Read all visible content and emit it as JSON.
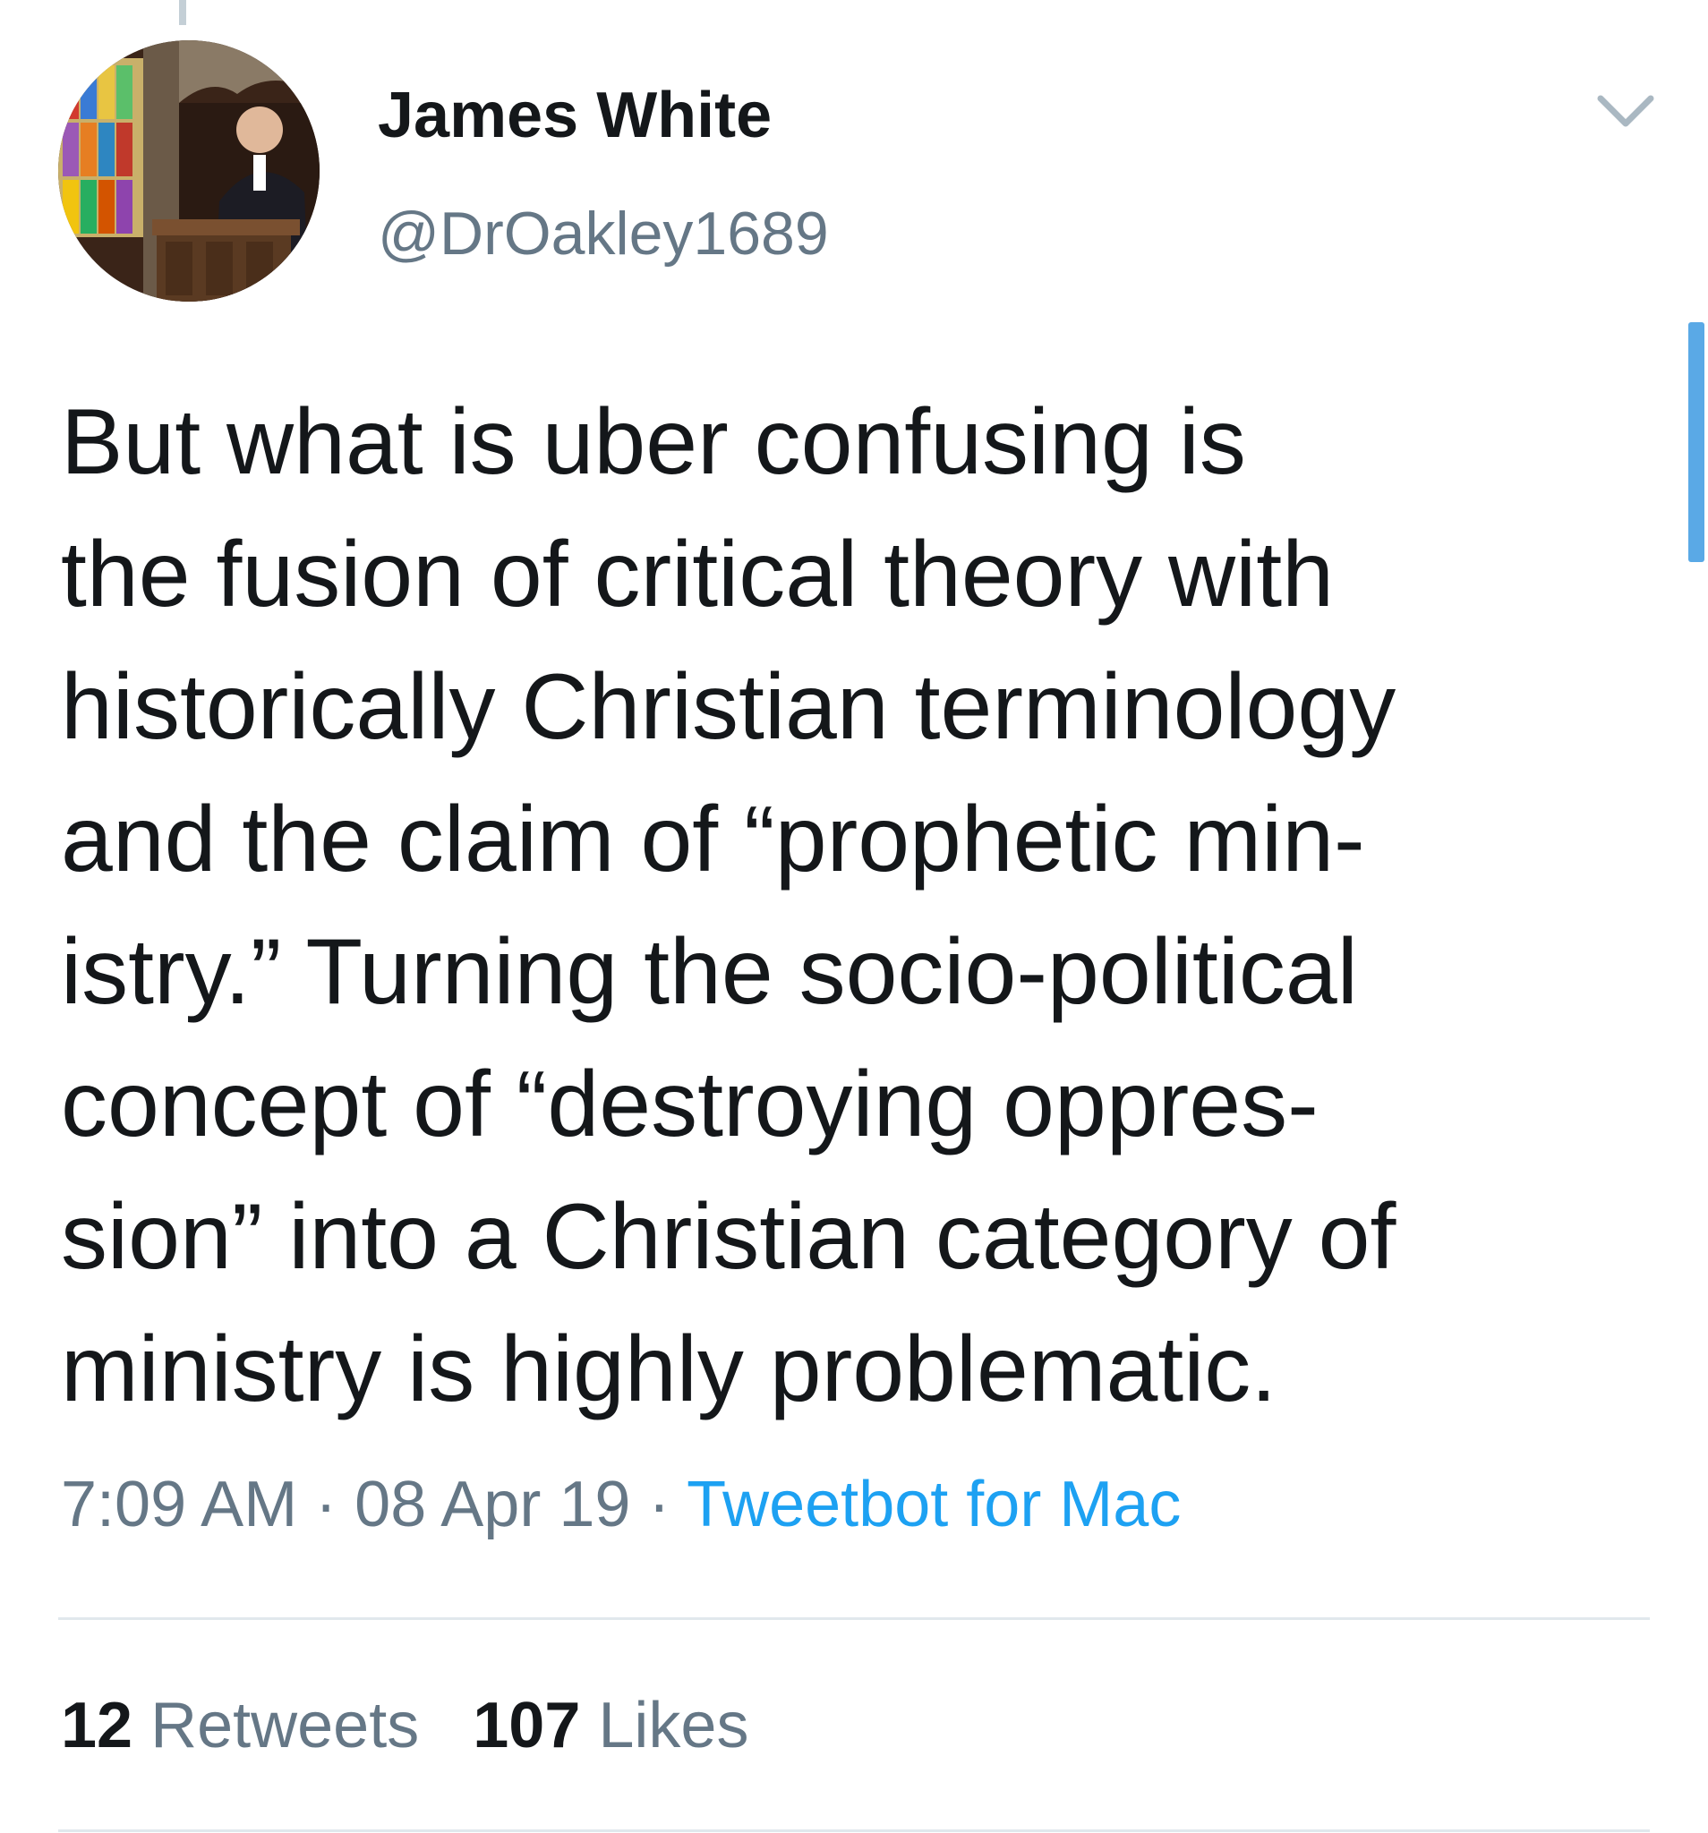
{
  "author": {
    "name": "James White",
    "handle": "@DrOakley1689"
  },
  "tweet": {
    "lines": [
      "But what is uber confusing is",
      "the fusion of critical theory with",
      "historically Christian terminology",
      "and the claim of “prophetic min-",
      "istry.” Turning the socio-political",
      "concept of “destroying oppres-",
      "sion” into a Christian category of",
      "ministry is highly problematic."
    ]
  },
  "meta": {
    "time": "7:09 AM",
    "separator": " · ",
    "date": "08 Apr 19",
    "source": "Tweetbot for Mac"
  },
  "stats": {
    "retweets_count": "12",
    "retweets_label": " Retweets",
    "likes_count": "107",
    "likes_label": " Likes"
  },
  "icons": {
    "menu": "chevron-down-icon",
    "avatar": "profile-photo"
  },
  "colors": {
    "text": "#14171a",
    "secondary": "#657786",
    "link": "#1da1f2",
    "divider": "#e1e8ed"
  }
}
